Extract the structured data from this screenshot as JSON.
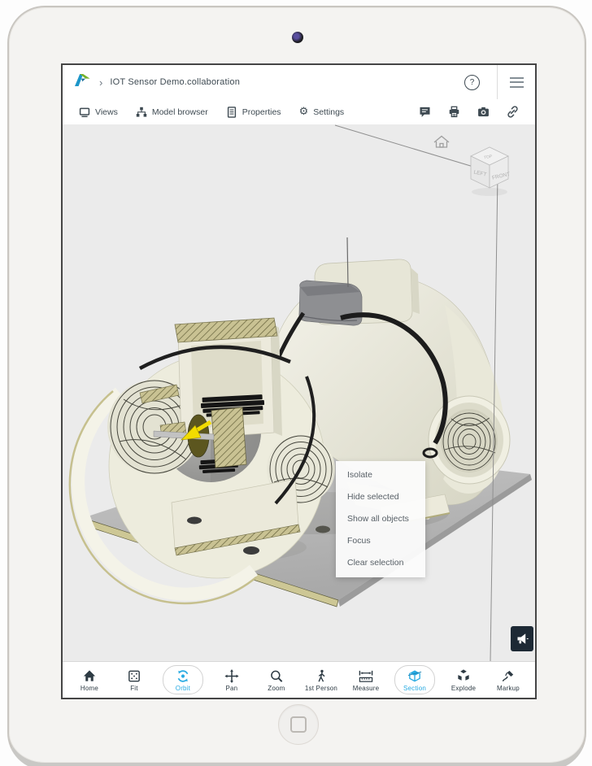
{
  "window": {
    "title": "IOT Sensor Demo.collaboration",
    "breadcrumb_chevron": "›",
    "help_label": "?"
  },
  "toolbar": {
    "items": [
      {
        "label": "Views",
        "icon": "views-icon"
      },
      {
        "label": "Model browser",
        "icon": "model-browser-icon"
      },
      {
        "label": "Properties",
        "icon": "properties-icon"
      },
      {
        "label": "Settings",
        "icon": "gear-icon"
      }
    ],
    "right_icons": [
      "comment-icon",
      "print-icon",
      "camera-icon",
      "link-icon"
    ],
    "gear_glyph": "⚙"
  },
  "viewcube": {
    "top": "TOP",
    "left": "LEFT",
    "front": "FRONT"
  },
  "context_menu": {
    "items": [
      "Isolate",
      "Hide selected",
      "Show all objects",
      "Focus",
      "Clear selection"
    ]
  },
  "bottom_toolbar": {
    "tools": [
      {
        "label": "Home",
        "active": false
      },
      {
        "label": "Fit",
        "active": false
      },
      {
        "label": "Orbit",
        "active": true
      },
      {
        "label": "Pan",
        "active": false
      },
      {
        "label": "Zoom",
        "active": false
      },
      {
        "label": "1st Person",
        "active": false
      },
      {
        "label": "Measure",
        "active": false
      },
      {
        "label": "Section",
        "active": true
      },
      {
        "label": "Explode",
        "active": false
      },
      {
        "label": "Markup",
        "active": false
      }
    ]
  },
  "colors": {
    "accent": "#29abe2",
    "viewer_bg": "#ebebeb",
    "ink": "#3e4a52",
    "menu_text": "#575f66",
    "megaphone_bg": "#1d2935",
    "logo_blue": "#1c96c9",
    "logo_green": "#77b22a",
    "hatch_khaki": "#c9c293",
    "ivory": "#efeee0",
    "plate_gray": "#b5b5b5",
    "arrow_yellow": "#f2dc00"
  }
}
